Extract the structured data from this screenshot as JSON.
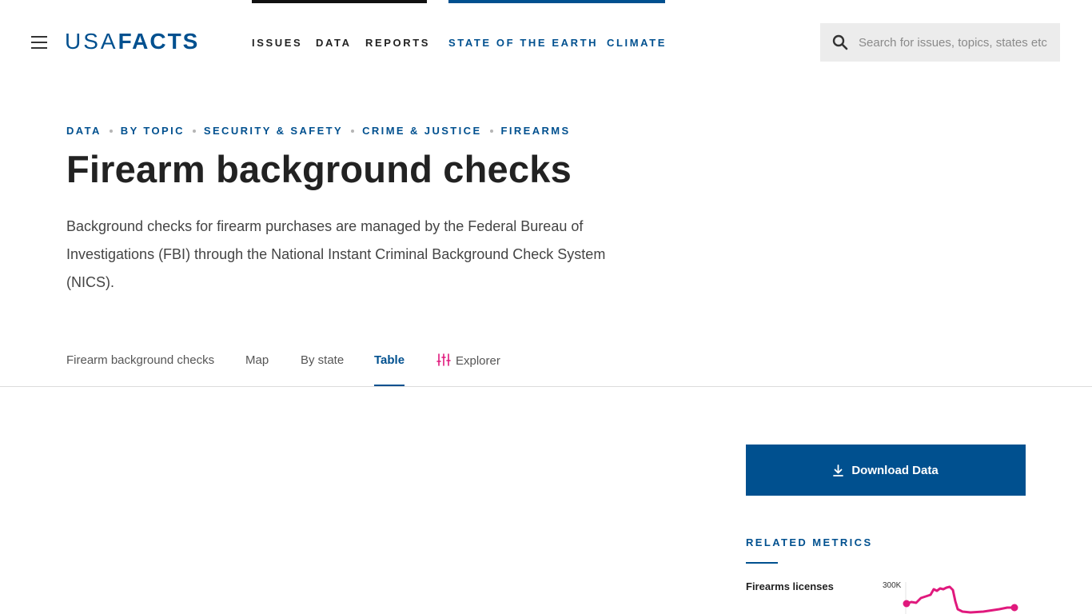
{
  "header": {
    "logo_thin": "USA",
    "logo_bold": "FACTS",
    "nav_primary": [
      "ISSUES",
      "DATA",
      "REPORTS"
    ],
    "nav_featured": [
      "STATE OF THE EARTH",
      "CLIMATE"
    ],
    "search_placeholder": "Search for issues, topics, states etc"
  },
  "breadcrumb": [
    "DATA",
    "BY TOPIC",
    "SECURITY & SAFETY",
    "CRIME & JUSTICE",
    "FIREARMS"
  ],
  "page": {
    "title": "Firearm background checks",
    "intro": "Background checks for firearm purchases are managed by the Federal Bureau of Investigations (FBI) through the National Instant Criminal Background Check System (NICS)."
  },
  "tabs": [
    {
      "label": "Firearm background checks",
      "active": false
    },
    {
      "label": "Map",
      "active": false
    },
    {
      "label": "By state",
      "active": false
    },
    {
      "label": "Table",
      "active": true
    },
    {
      "label": "Explorer",
      "active": false
    }
  ],
  "sidebar": {
    "download_label": "Download Data",
    "related_title": "RELATED METRICS",
    "metrics": [
      {
        "name": "Firearms licenses",
        "sparkline_label": "300K"
      }
    ]
  },
  "colors": {
    "brand_blue": "#00508f",
    "sparkline": "#e0197d",
    "explorer_icon": "#e0197d"
  },
  "icons": [
    "menu-icon",
    "search-icon",
    "explorer-sliders-icon",
    "download-icon"
  ]
}
